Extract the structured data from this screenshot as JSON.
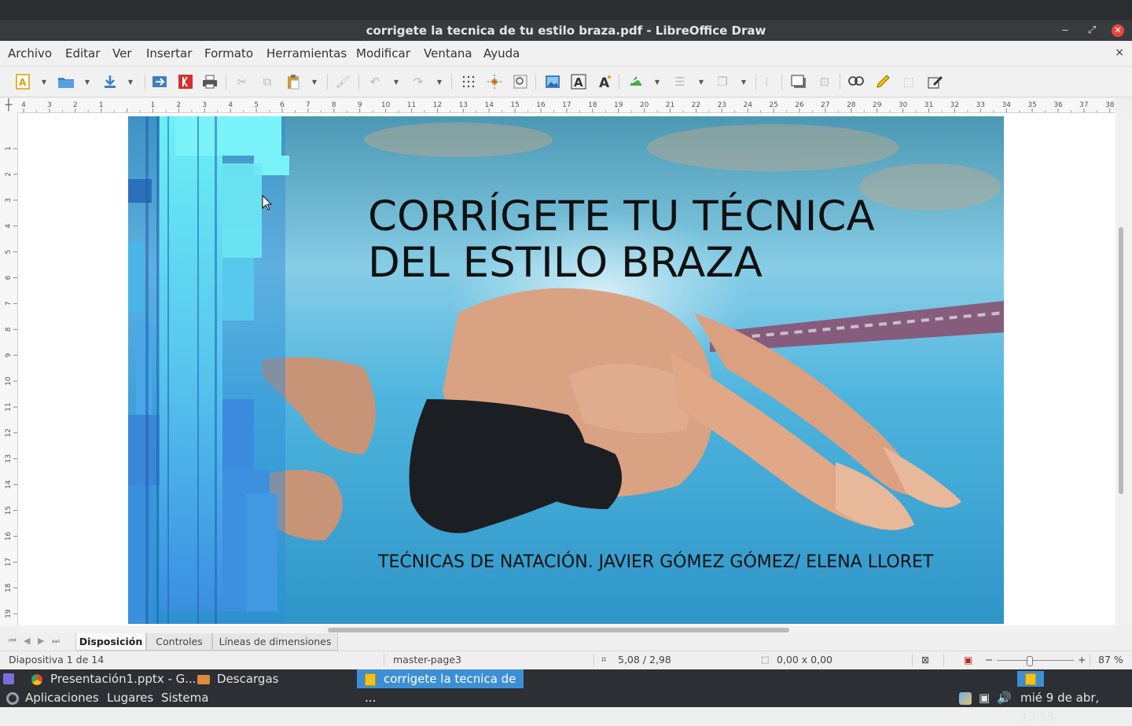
{
  "window": {
    "title": "corrigete la tecnica de tu estilo braza.pdf - LibreOffice Draw"
  },
  "menubar": {
    "items": [
      "Archivo",
      "Editar",
      "Ver",
      "Insertar",
      "Formato",
      "Herramientas",
      "Modificar",
      "Ventana",
      "Ayuda"
    ],
    "close_icon": "×"
  },
  "ruler": {
    "h_labels": [
      "4",
      "3",
      "2",
      "1",
      "",
      "1",
      "2",
      "3",
      "4",
      "5",
      "6",
      "7",
      "8",
      "9",
      "10",
      "11",
      "12",
      "13",
      "14",
      "15",
      "16",
      "17",
      "18",
      "19",
      "20",
      "21",
      "22",
      "23",
      "24",
      "25",
      "26",
      "27",
      "28",
      "29",
      "30",
      "31",
      "32",
      "33",
      "34",
      "35",
      "36",
      "37",
      "38"
    ],
    "v_labels": [
      "1",
      "2",
      "3",
      "4",
      "5",
      "6",
      "7",
      "8",
      "9",
      "10",
      "11",
      "12",
      "13",
      "14",
      "15",
      "16",
      "17",
      "18",
      "19"
    ]
  },
  "slide": {
    "title_line1": "CORRÍGETE TU TÉCNICA",
    "title_line2": "DEL ESTILO BRAZA",
    "subtitle": "TEĆNICAS DE NATACIÓN. JAVIER GÓMEZ GÓMEZ/ ELENA LLORET",
    "image": "swimmer-underwater-photo"
  },
  "tabs": {
    "items": [
      "Disposición",
      "Controles",
      "Líneas de dimensiones"
    ],
    "active": "Disposición"
  },
  "statusbar": {
    "slide_info": "Diapositiva 1 de 14",
    "master": "master-page3",
    "position": "5,08 / 2,98",
    "size": "0,00 x 0,00",
    "zoom_minus": "−",
    "zoom_plus": "+",
    "zoom": "87 %"
  },
  "taskbar": {
    "tasks": [
      {
        "label": "Presentación1.pptx - G...",
        "icon": "chrome-icon"
      },
      {
        "label": "Descargas",
        "icon": "folder-icon"
      },
      {
        "label": "corrigete la tecnica de ...",
        "icon": "libreoffice-draw-icon",
        "active": true
      }
    ],
    "menus": [
      "Aplicaciones",
      "Lugares",
      "Sistema"
    ],
    "clock": "mié  9 de abr, 13:18"
  },
  "colors": {
    "accent": "#3d8fd5",
    "window_close": "#e9473d",
    "taskbar": "#2c2f33",
    "slide_water": "#4fb3da"
  }
}
